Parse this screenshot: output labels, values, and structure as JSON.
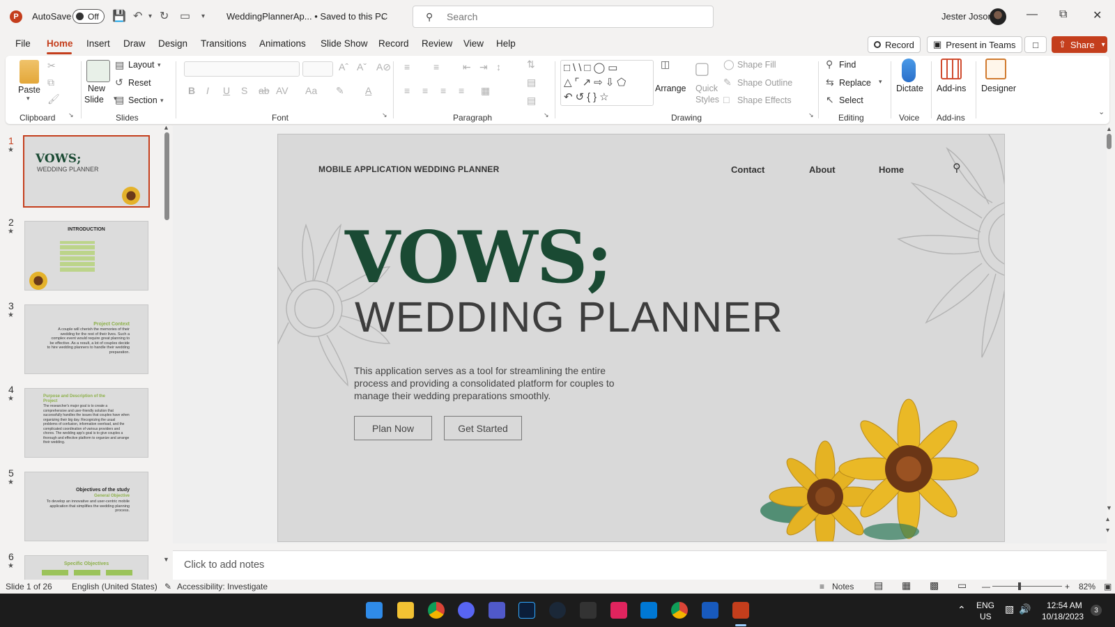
{
  "titlebar": {
    "app_letter": "P",
    "autosave_label": "AutoSave",
    "autosave_state": "Off",
    "doc_title": "WeddingPlannerAp... • Saved to this PC",
    "search_placeholder": "Search",
    "user_name": "Jester Joson"
  },
  "menu": {
    "items": [
      "File",
      "Home",
      "Insert",
      "Draw",
      "Design",
      "Transitions",
      "Animations",
      "Slide Show",
      "Record",
      "Review",
      "View",
      "Help"
    ],
    "active": "Home",
    "record_btn": "Record",
    "present_btn": "Present in Teams",
    "share_btn": "Share"
  },
  "ribbon": {
    "clipboard": {
      "label": "Clipboard",
      "paste": "Paste"
    },
    "slides": {
      "label": "Slides",
      "new_slide": "New",
      "new_slide2": "Slide",
      "layout": "Layout",
      "reset": "Reset",
      "section": "Section"
    },
    "font": {
      "label": "Font"
    },
    "paragraph": {
      "label": "Paragraph"
    },
    "drawing": {
      "label": "Drawing",
      "arrange": "Arrange",
      "quick_styles": "Quick",
      "quick_styles2": "Styles",
      "shape_fill": "Shape Fill",
      "shape_outline": "Shape Outline",
      "shape_effects": "Shape Effects"
    },
    "editing": {
      "label": "Editing",
      "find": "Find",
      "replace": "Replace",
      "select": "Select"
    },
    "voice": {
      "label": "Voice",
      "dictate": "Dictate"
    },
    "addins": {
      "label": "Add-ins",
      "addins_btn": "Add-ins"
    },
    "designer": {
      "label": "Designer"
    }
  },
  "thumbnails": [
    {
      "num": "1",
      "title": "VOWS;",
      "sub": "WEDDING PLANNER"
    },
    {
      "num": "2",
      "title": "INTRODUCTION"
    },
    {
      "num": "3",
      "title": "Project Context",
      "body": "A couple will cherish the memories of their wedding for the rest of their lives. Such a complex event would require great planning to be effective. As a result, a lot of couples decide to hire wedding planners to handle their wedding preparation."
    },
    {
      "num": "4",
      "title": "Purpose and Description of the Project",
      "body": "The researcher's major goal is to create a comprehensive and user-friendly solution that successfully handles the issues that couples have when organizing their big day. Recognizing the usual problems of confusion, information overload, and the complicated coordination of various providers and chores. The wedding app's goal is to give couples a thorough and effective platform to organize and arrange their wedding."
    },
    {
      "num": "5",
      "title": "Objectives of the study",
      "subtitle": "General Objective",
      "body": "To develop an innovative and user-centric mobile application that simplifies the wedding planning process."
    },
    {
      "num": "6",
      "title": "Specific Objectives"
    }
  ],
  "slide": {
    "nav_title": "MOBILE APPLICATION WEDDING PLANNER",
    "nav_links": [
      "Contact",
      "About",
      "Home"
    ],
    "title": "VOWS;",
    "subtitle": "WEDDING PLANNER",
    "description": "This application serves as a tool for streamlining the entire process and providing a consolidated platform for couples to manage their wedding preparations smoothly.",
    "btn_primary": "Plan Now",
    "btn_secondary": "Get Started"
  },
  "notes_placeholder": "Click to add notes",
  "status": {
    "slide_info": "Slide 1 of 26",
    "language": "English (United States)",
    "accessibility": "Accessibility: Investigate",
    "notes": "Notes",
    "zoom": "82%"
  },
  "taskbar": {
    "lang1": "ENG",
    "lang2": "US",
    "time": "12:54 AM",
    "date": "10/18/2023",
    "badge": "3"
  },
  "colors": {
    "accent": "#c43e1c",
    "vows_green": "#1a4a33",
    "slide_bg": "#d9d9d9"
  }
}
